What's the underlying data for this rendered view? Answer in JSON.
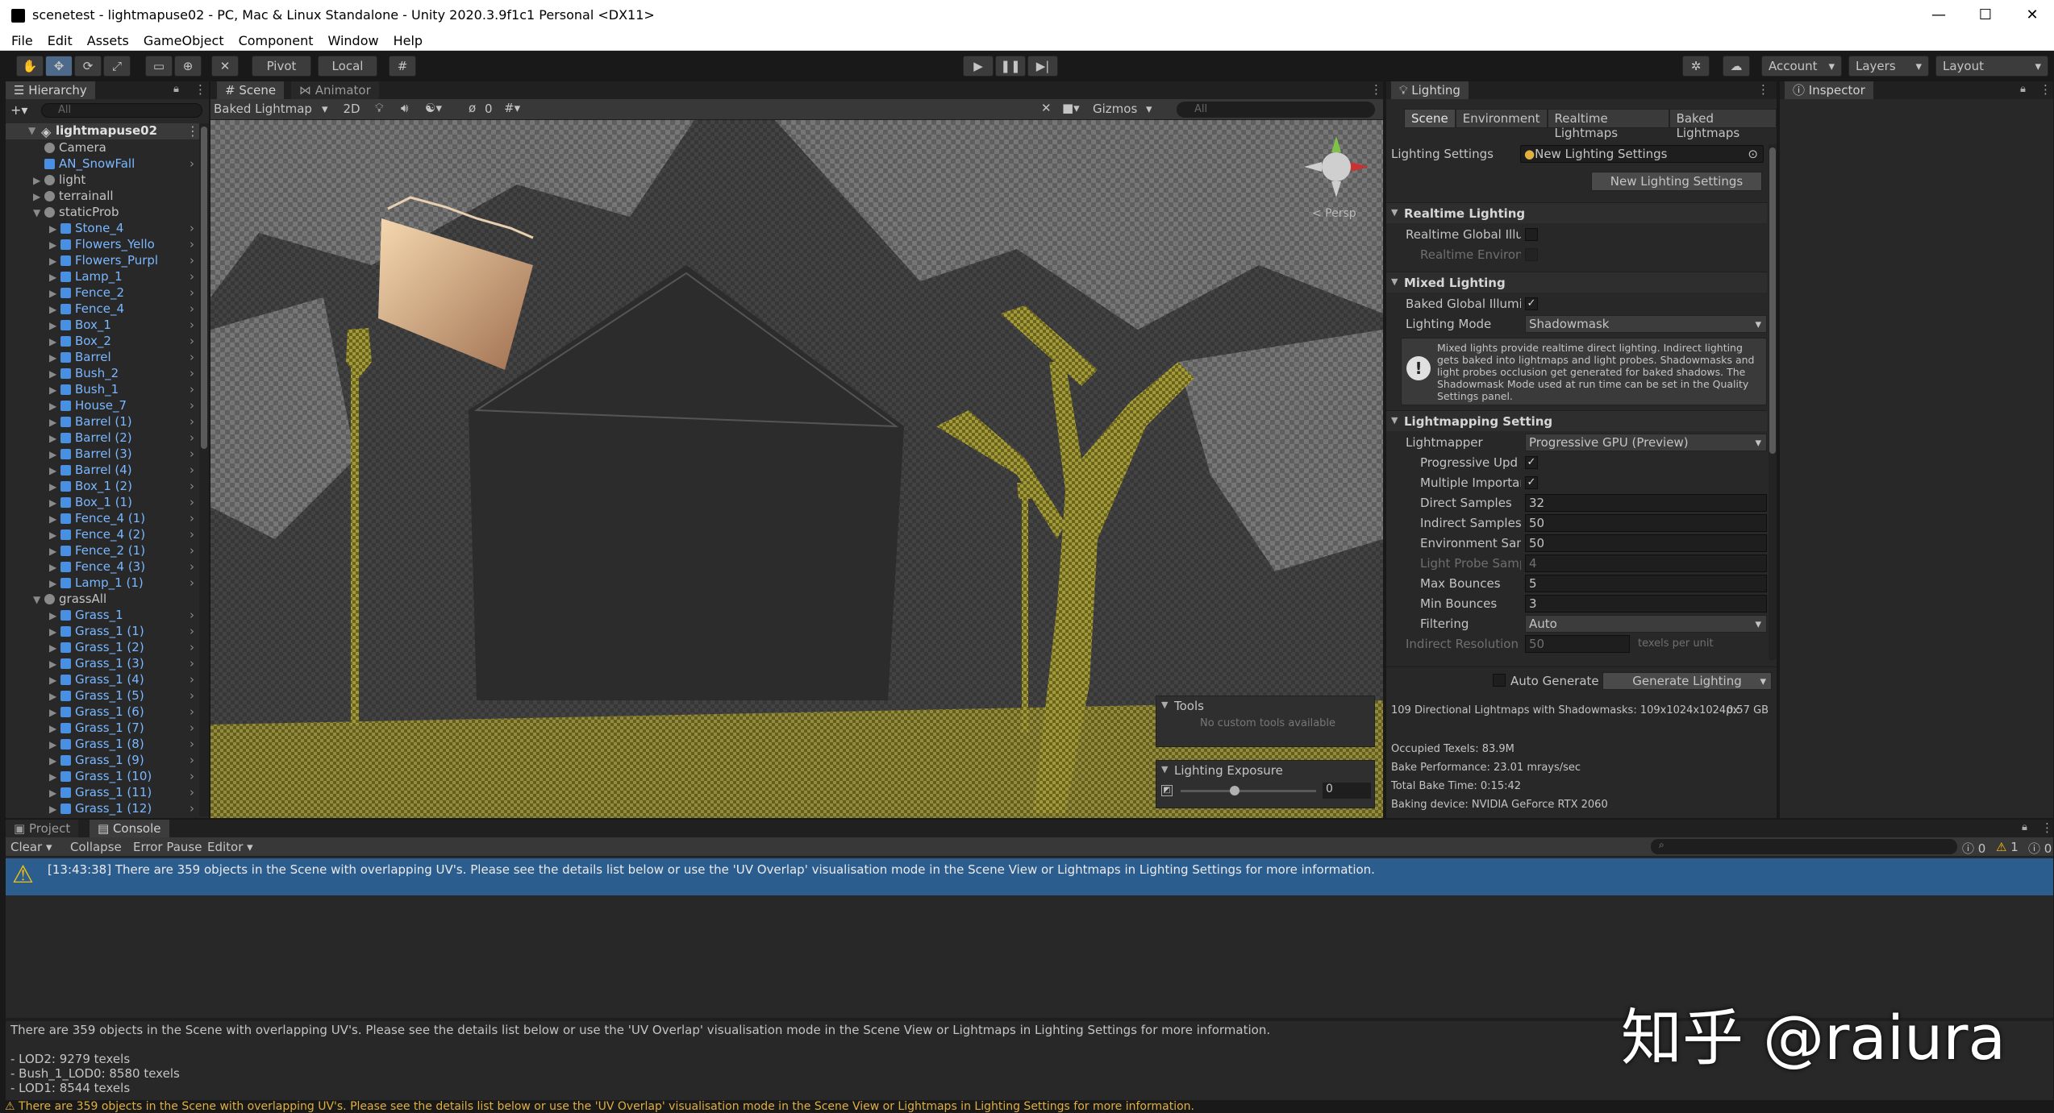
{
  "window": {
    "title": "scenetest - lightmapuse02 - PC, Mac & Linux Standalone - Unity 2020.3.9f1c1 Personal <DX11>",
    "min": "—",
    "max": "☐",
    "close": "✕"
  },
  "menu": [
    "File",
    "Edit",
    "Assets",
    "GameObject",
    "Component",
    "Window",
    "Help"
  ],
  "toolbar": {
    "pivot": "Pivot",
    "local": "Local",
    "account": "Account",
    "layers": "Layers",
    "layout": "Layout"
  },
  "hierarchy": {
    "tab": "Hierarchy",
    "search_placeholder": "All",
    "scene": "lightmapuse02",
    "items": [
      {
        "name": "Camera",
        "indent": 1,
        "kind": "gray",
        "arrow": "",
        "blue": false
      },
      {
        "name": "AN_SnowFall",
        "indent": 1,
        "kind": "blue",
        "arrow": "",
        "blue": true
      },
      {
        "name": "light",
        "indent": 1,
        "kind": "gray",
        "arrow": "▶",
        "blue": false
      },
      {
        "name": "terrainall",
        "indent": 1,
        "kind": "gray",
        "arrow": "▶",
        "blue": false
      },
      {
        "name": "staticProb",
        "indent": 1,
        "kind": "gray",
        "arrow": "▼",
        "blue": false
      },
      {
        "name": "Stone_4",
        "indent": 2,
        "kind": "blue",
        "arrow": "▶",
        "blue": true
      },
      {
        "name": "Flowers_Yello",
        "indent": 2,
        "kind": "blue",
        "arrow": "▶",
        "blue": true
      },
      {
        "name": "Flowers_Purpl",
        "indent": 2,
        "kind": "blue",
        "arrow": "▶",
        "blue": true
      },
      {
        "name": "Lamp_1",
        "indent": 2,
        "kind": "blue",
        "arrow": "▶",
        "blue": true
      },
      {
        "name": "Fence_2",
        "indent": 2,
        "kind": "blue",
        "arrow": "▶",
        "blue": true
      },
      {
        "name": "Fence_4",
        "indent": 2,
        "kind": "blue",
        "arrow": "▶",
        "blue": true
      },
      {
        "name": "Box_1",
        "indent": 2,
        "kind": "blue",
        "arrow": "▶",
        "blue": true
      },
      {
        "name": "Box_2",
        "indent": 2,
        "kind": "blue",
        "arrow": "▶",
        "blue": true
      },
      {
        "name": "Barrel",
        "indent": 2,
        "kind": "blue",
        "arrow": "▶",
        "blue": true
      },
      {
        "name": "Bush_2",
        "indent": 2,
        "kind": "blue",
        "arrow": "▶",
        "blue": true
      },
      {
        "name": "Bush_1",
        "indent": 2,
        "kind": "blue",
        "arrow": "▶",
        "blue": true
      },
      {
        "name": "House_7",
        "indent": 2,
        "kind": "blue",
        "arrow": "▶",
        "blue": true
      },
      {
        "name": "Barrel (1)",
        "indent": 2,
        "kind": "blue",
        "arrow": "▶",
        "blue": true
      },
      {
        "name": "Barrel (2)",
        "indent": 2,
        "kind": "blue",
        "arrow": "▶",
        "blue": true
      },
      {
        "name": "Barrel (3)",
        "indent": 2,
        "kind": "blue",
        "arrow": "▶",
        "blue": true
      },
      {
        "name": "Barrel (4)",
        "indent": 2,
        "kind": "blue",
        "arrow": "▶",
        "blue": true
      },
      {
        "name": "Box_1 (2)",
        "indent": 2,
        "kind": "blue",
        "arrow": "▶",
        "blue": true
      },
      {
        "name": "Box_1 (1)",
        "indent": 2,
        "kind": "blue",
        "arrow": "▶",
        "blue": true
      },
      {
        "name": "Fence_4 (1)",
        "indent": 2,
        "kind": "blue",
        "arrow": "▶",
        "blue": true
      },
      {
        "name": "Fence_4 (2)",
        "indent": 2,
        "kind": "blue",
        "arrow": "▶",
        "blue": true
      },
      {
        "name": "Fence_2 (1)",
        "indent": 2,
        "kind": "blue",
        "arrow": "▶",
        "blue": true
      },
      {
        "name": "Fence_4 (3)",
        "indent": 2,
        "kind": "blue",
        "arrow": "▶",
        "blue": true
      },
      {
        "name": "Lamp_1 (1)",
        "indent": 2,
        "kind": "blue",
        "arrow": "▶",
        "blue": true
      },
      {
        "name": "grassAll",
        "indent": 1,
        "kind": "gray",
        "arrow": "▼",
        "blue": false
      },
      {
        "name": "Grass_1",
        "indent": 2,
        "kind": "blue",
        "arrow": "▶",
        "blue": true
      },
      {
        "name": "Grass_1 (1)",
        "indent": 2,
        "kind": "blue",
        "arrow": "▶",
        "blue": true
      },
      {
        "name": "Grass_1 (2)",
        "indent": 2,
        "kind": "blue",
        "arrow": "▶",
        "blue": true
      },
      {
        "name": "Grass_1 (3)",
        "indent": 2,
        "kind": "blue",
        "arrow": "▶",
        "blue": true
      },
      {
        "name": "Grass_1 (4)",
        "indent": 2,
        "kind": "blue",
        "arrow": "▶",
        "blue": true
      },
      {
        "name": "Grass_1 (5)",
        "indent": 2,
        "kind": "blue",
        "arrow": "▶",
        "blue": true
      },
      {
        "name": "Grass_1 (6)",
        "indent": 2,
        "kind": "blue",
        "arrow": "▶",
        "blue": true
      },
      {
        "name": "Grass_1 (7)",
        "indent": 2,
        "kind": "blue",
        "arrow": "▶",
        "blue": true
      },
      {
        "name": "Grass_1 (8)",
        "indent": 2,
        "kind": "blue",
        "arrow": "▶",
        "blue": true
      },
      {
        "name": "Grass_1 (9)",
        "indent": 2,
        "kind": "blue",
        "arrow": "▶",
        "blue": true
      },
      {
        "name": "Grass_1 (10)",
        "indent": 2,
        "kind": "blue",
        "arrow": "▶",
        "blue": true
      },
      {
        "name": "Grass_1 (11)",
        "indent": 2,
        "kind": "blue",
        "arrow": "▶",
        "blue": true
      },
      {
        "name": "Grass_1 (12)",
        "indent": 2,
        "kind": "blue",
        "arrow": "▶",
        "blue": true
      }
    ]
  },
  "scene": {
    "tabs": [
      "Scene",
      "Animator"
    ],
    "draw_mode": "Baked Lightmap",
    "btn_2d": "2D",
    "hidden_count": "0",
    "gizmos": "Gizmos",
    "search_placeholder": "All",
    "persp": "< Persp",
    "tools_title": "Tools",
    "tools_empty": "No custom tools available",
    "exposure_title": "Lighting Exposure",
    "exposure_value": "0",
    "exposure_level": 0.4
  },
  "lighting": {
    "tab": "Lighting",
    "subtabs": [
      "Scene",
      "Environment",
      "Realtime Lightmaps",
      "Baked Lightmaps"
    ],
    "settings_label": "Lighting Settings",
    "settings_value": "New Lighting Settings",
    "new_btn": "New Lighting Settings",
    "realtime_header": "Realtime Lighting",
    "realtime_gi": "Realtime Global Illur",
    "realtime_env": "Realtime Environ",
    "mixed_header": "Mixed Lighting",
    "baked_gi": "Baked Global Illumi",
    "mode_label": "Lighting Mode",
    "mode_value": "Shadowmask",
    "help": "Mixed lights provide realtime direct lighting. Indirect lighting gets baked into lightmaps and light probes. Shadowmasks and light probes occlusion get generated for baked shadows. The Shadowmask Mode used at run time can be set in the Quality Settings panel.",
    "lm_header": "Lightmapping Setting",
    "lightmapper_label": "Lightmapper",
    "lightmapper_value": "Progressive GPU (Preview)",
    "prog_label": "Progressive Upd",
    "multi_label": "Multiple Importar",
    "direct_label": "Direct Samples",
    "direct_value": "32",
    "indirect_label": "Indirect Samples",
    "indirect_value": "50",
    "env_label": "Environment Sam",
    "env_value": "50",
    "probe_label": "Light Probe Samp",
    "probe_value": "4",
    "maxb_label": "Max Bounces",
    "maxb_value": "5",
    "minb_label": "Min Bounces",
    "minb_value": "3",
    "filter_label": "Filtering",
    "filter_value": "Auto",
    "indres_label": "Indirect Resolution",
    "indres_value": "50",
    "indres_unit": "texels per unit",
    "auto_label": "Auto Generate",
    "generate_btn": "Generate Lighting",
    "stat1": "109 Directional Lightmaps with Shadowmasks: 109x1024x1024px",
    "stat1_size": "0.57 GB",
    "stat2": "Occupied Texels: 83.9M",
    "stat3": "Bake Performance: 23.01 mrays/sec",
    "stat4": "Total Bake Time: 0:15:42",
    "stat5": "Baking device: NVIDIA GeForce RTX 2060"
  },
  "inspector": {
    "tab": "Inspector"
  },
  "console": {
    "tabs": [
      "Project",
      "Console"
    ],
    "clear": "Clear",
    "collapse": "Collapse",
    "error_pause": "Error Pause",
    "editor": "Editor",
    "count_info": "0",
    "count_warn": "1",
    "count_err": "0",
    "entry": "[13:43:38] There are 359 objects in the Scene with overlapping UV's. Please see the details list below or use the 'UV Overlap' visualisation mode in the Scene View or Lightmaps in Lighting Settings for more information.",
    "detail": "There are 359 objects in the Scene with overlapping UV's. Please see the details list below or use the 'UV Overlap' visualisation mode in the Scene View or Lightmaps in Lighting Settings for more information.",
    "detail_lines": [
      "- LOD2: 9279 texels",
      "- Bush_1_LOD0: 8580 texels",
      "- LOD1: 8544 texels"
    ],
    "status": "There are 359 objects in the Scene with overlapping UV's. Please see the details list below or use the 'UV Overlap' visualisation mode in the Scene View or Lightmaps in Lighting Settings for more information."
  },
  "watermark": "知乎 @raiura"
}
